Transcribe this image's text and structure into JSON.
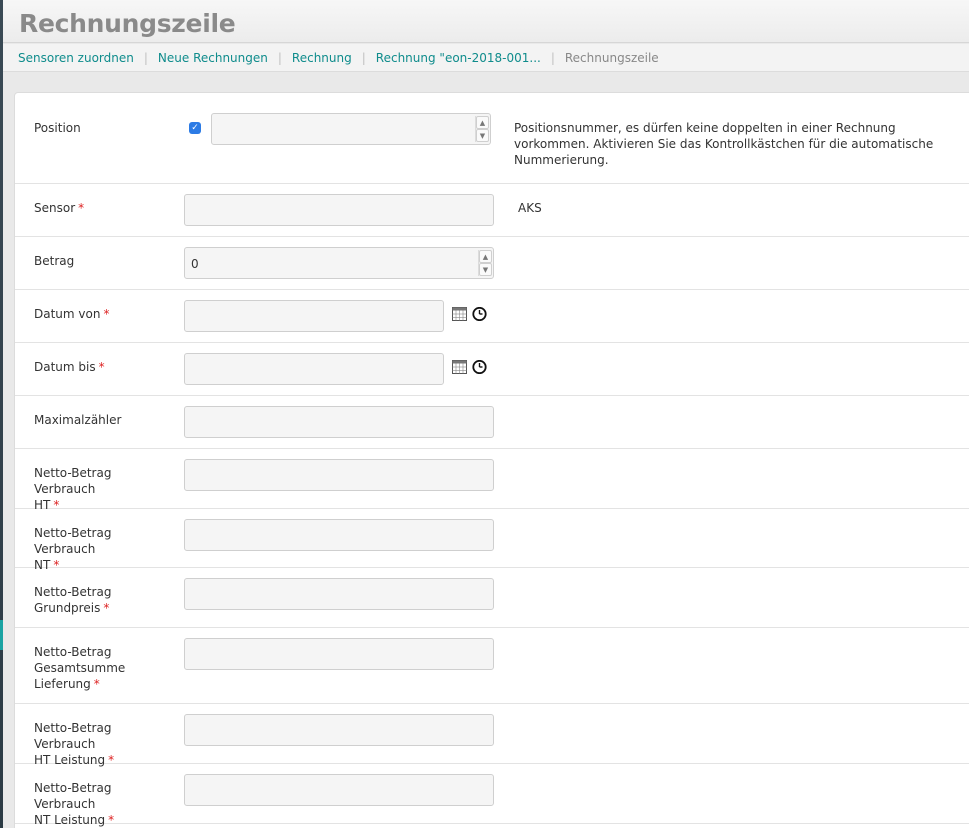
{
  "header": {
    "title": "Rechnungszeile"
  },
  "breadcrumb": [
    {
      "label": "Sensoren zuordnen"
    },
    {
      "label": "Neue Rechnungen"
    },
    {
      "label": "Rechnung"
    },
    {
      "label": "Rechnung \"eon-2018-001..."
    },
    {
      "label": "Rechnungszeile"
    }
  ],
  "form": {
    "position": {
      "label": "Position",
      "auto_numbering_checked": true,
      "value": "",
      "hint": [
        "Positionsnummer, es dürfen keine doppelten in einer Rechnung",
        "vorkommen. Aktivieren Sie das Kontrollkästchen für die automatische",
        "Nummerierung."
      ]
    },
    "sensor": {
      "label": "Sensor",
      "required_mark": "*",
      "value": "",
      "hint": "AKS"
    },
    "betrag": {
      "label": "Betrag",
      "value": "0"
    },
    "datum_von": {
      "label": "Datum von",
      "required_mark": "*",
      "value": ""
    },
    "datum_bis": {
      "label": "Datum bis",
      "required_mark": "*",
      "value": ""
    },
    "maximalzaehler": {
      "label": "Maximalzähler",
      "value": ""
    },
    "netto_ht": {
      "label_lines": [
        "Netto-Betrag Verbrauch",
        "HT"
      ],
      "required_mark": "*",
      "value": ""
    },
    "netto_nt": {
      "label_lines": [
        "Netto-Betrag Verbrauch",
        "NT"
      ],
      "required_mark": "*",
      "value": ""
    },
    "netto_grundpreis": {
      "label_lines": [
        "Netto-Betrag",
        "Grundpreis"
      ],
      "required_mark": "*",
      "value": ""
    },
    "netto_gesamtsumme": {
      "label_lines": [
        "Netto-Betrag",
        "Gesamtsumme",
        "Lieferung"
      ],
      "required_mark": "*",
      "value": ""
    },
    "netto_ht_leistung": {
      "label_lines": [
        "Netto-Betrag Verbrauch",
        "HT Leistung"
      ],
      "required_mark": "*",
      "value": ""
    },
    "netto_nt_leistung": {
      "label_lines": [
        "Netto-Betrag Verbrauch",
        "NT Leistung"
      ],
      "required_mark": "*",
      "value": ""
    }
  },
  "icons": {
    "calendar": "calendar-icon",
    "clock": "clock-icon",
    "checkbox": "checkmark"
  },
  "colors": {
    "link": "#0f8c8c",
    "required": "#dd2222",
    "checkbox": "#2c7be5"
  }
}
